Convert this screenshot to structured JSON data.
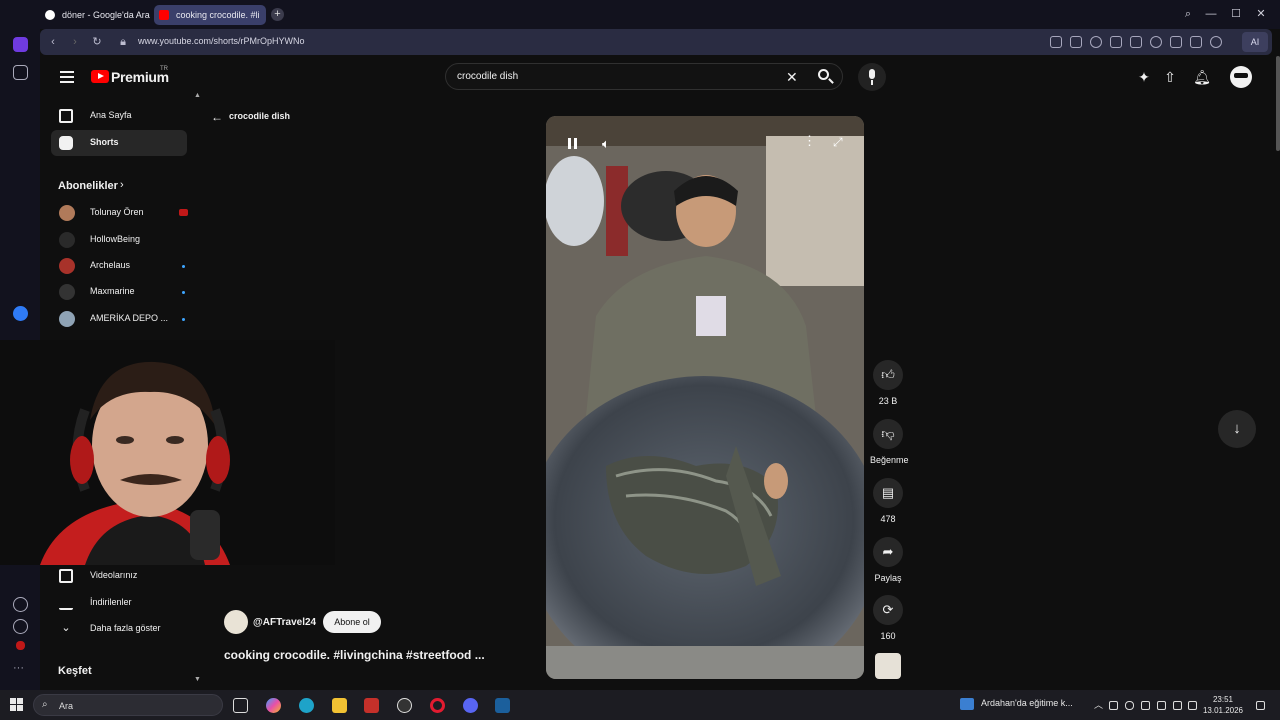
{
  "browser": {
    "tabs": [
      {
        "label": "döner - Google'da Ara"
      },
      {
        "label": "cooking crocodile. #li"
      }
    ],
    "url": "www.youtube.com/shorts/rPMrOpHYWNo",
    "ai_label": "AI"
  },
  "header": {
    "logo": "Premium",
    "region": "TR",
    "search_value": "crocodile dish"
  },
  "sidebar": {
    "home": "Ana Sayfa",
    "shorts": "Shorts",
    "subscriptions_title": "Abonelikler",
    "subscriptions": [
      {
        "name": "Tolunay Ören",
        "avatar_color": "#b07a5a"
      },
      {
        "name": "HollowBeing",
        "avatar_color": "#2a2a2a"
      },
      {
        "name": "Archelaus",
        "avatar_color": "#a8322a"
      },
      {
        "name": "Maxmarine",
        "avatar_color": "#333"
      },
      {
        "name": "AMERİKA DEPO ...",
        "avatar_color": "#8fa3b5"
      }
    ],
    "your_videos": "Videolarınız",
    "downloads": "İndirilenler",
    "show_more": "Daha fazla göster",
    "explore": "Keşfet"
  },
  "short": {
    "back_label": "crocodile dish",
    "channel": "@AFTravel24",
    "subscribe": "Abone ol",
    "caption": "cooking crocodile. #livingchina #streetfood ...",
    "likes": "23 B",
    "dislike_label": "Beğenme",
    "comments": "478",
    "share_label": "Paylaş",
    "remix_count": "160"
  },
  "taskbar": {
    "search_placeholder": "Ara",
    "weather": "Ardahan'da eğitime k...",
    "time": "23:51",
    "date": "13.01.2026"
  },
  "colors": {
    "accent": "#ff0000",
    "background": "#0f0f0f",
    "link_blue": "#3ea6ff"
  }
}
